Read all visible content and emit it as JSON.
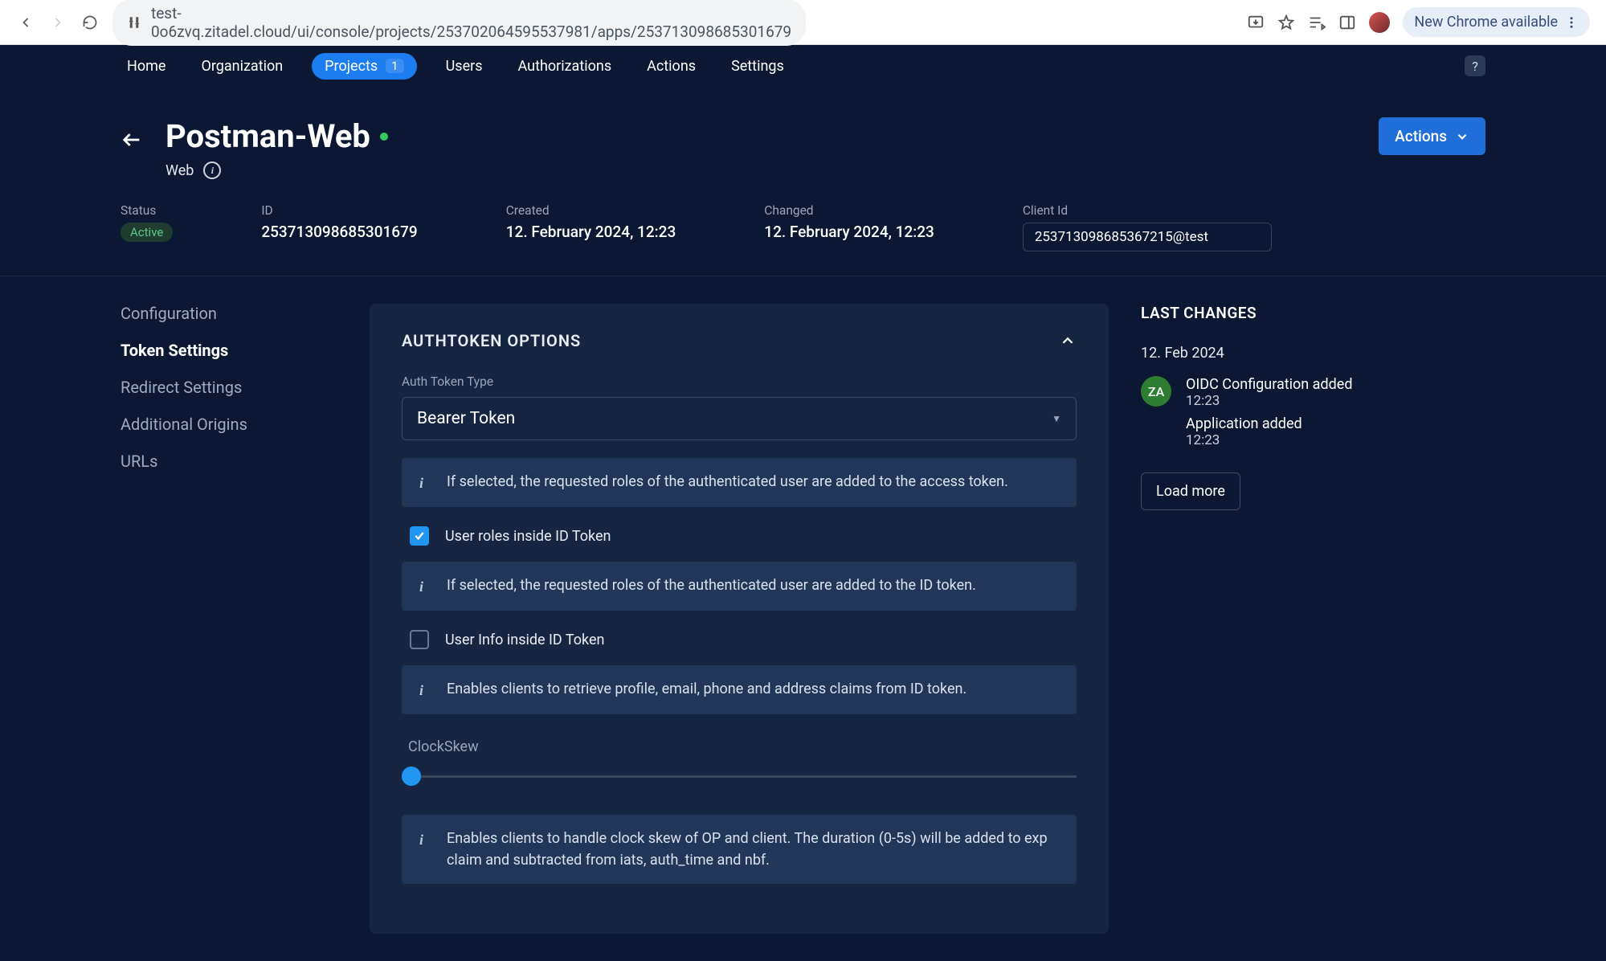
{
  "chrome": {
    "url": "test-0o6zvq.zitadel.cloud/ui/console/projects/253702064595537981/apps/253713098685301679",
    "update_label": "New Chrome available"
  },
  "nav": {
    "home": "Home",
    "organization": "Organization",
    "projects": "Projects",
    "projects_count": "1",
    "users": "Users",
    "authorizations": "Authorizations",
    "actions": "Actions",
    "settings": "Settings",
    "help": "?"
  },
  "header": {
    "title": "Postman-Web",
    "type": "Web",
    "actions_btn": "Actions",
    "status_label": "Status",
    "status_value": "Active",
    "id_label": "ID",
    "id_value": "253713098685301679",
    "created_label": "Created",
    "created_value": "12. February 2024, 12:23",
    "changed_label": "Changed",
    "changed_value": "12. February 2024, 12:23",
    "clientid_label": "Client Id",
    "clientid_value": "253713098685367215@test"
  },
  "sidenav": {
    "configuration": "Configuration",
    "token_settings": "Token Settings",
    "redirect_settings": "Redirect Settings",
    "additional_origins": "Additional Origins",
    "urls": "URLs"
  },
  "card": {
    "title": "AUTHTOKEN OPTIONS",
    "auth_token_type_label": "Auth Token Type",
    "auth_token_type_value": "Bearer Token",
    "info1": "If selected, the requested roles of the authenticated user are added to the access token.",
    "cb1_label": "User roles inside ID Token",
    "info2": "If selected, the requested roles of the authenticated user are added to the ID token.",
    "cb2_label": "User Info inside ID Token",
    "info3": "Enables clients to retrieve profile, email, phone and address claims from ID token.",
    "clockskew_label": "ClockSkew",
    "info4": "Enables clients to handle clock skew of OP and client. The duration (0-5s) will be added to exp claim and subtracted from iats, auth_time and nbf."
  },
  "right": {
    "title": "LAST CHANGES",
    "date": "12. Feb 2024",
    "avatar_initials": "ZA",
    "change1_title": "OIDC Configuration added",
    "change1_time": "12:23",
    "change2_title": "Application added",
    "change2_time": "12:23",
    "load_more": "Load more"
  }
}
